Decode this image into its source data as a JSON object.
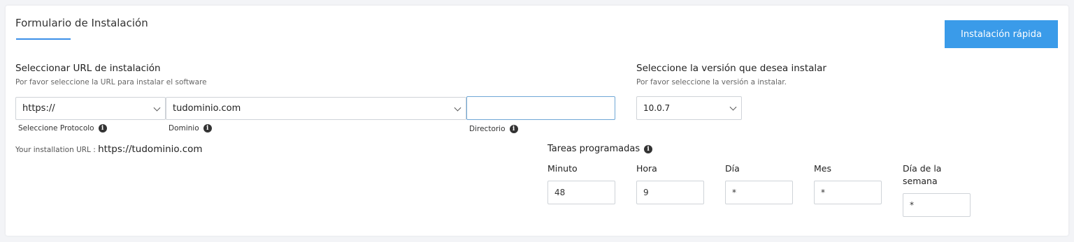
{
  "form": {
    "title": "Formulario de Instalación",
    "quick_install_label": "Instalación rápida"
  },
  "url_section": {
    "title": "Seleccionar URL de instalación",
    "subtitle": "Por favor seleccione la URL para instalar el software",
    "protocol": {
      "value": "https://",
      "label": "Seleccione Protocolo"
    },
    "domain": {
      "value": "tudominio.com",
      "label": "Dominio"
    },
    "directory": {
      "value": "",
      "label": "Directorio"
    },
    "installation_url_prefix": "Your installation URL :",
    "installation_url_value": "https://tudominio.com"
  },
  "version_section": {
    "title": "Seleccione la versión que desea instalar",
    "subtitle": "Por favor seleccione la versión a instalar.",
    "version": "10.0.7"
  },
  "cron": {
    "title": "Tareas programadas",
    "fields": [
      {
        "label": "Minuto",
        "value": "48"
      },
      {
        "label": "Hora",
        "value": "9"
      },
      {
        "label": "Día",
        "value": "*"
      },
      {
        "label": "Mes",
        "value": "*"
      },
      {
        "label": "Día de la semana",
        "value": "*"
      }
    ]
  },
  "icons": {
    "info": "info-icon",
    "dropdown": "chevron-down-icon"
  },
  "colors": {
    "accent": "#3a9be9",
    "underline": "#3b8fe8"
  }
}
